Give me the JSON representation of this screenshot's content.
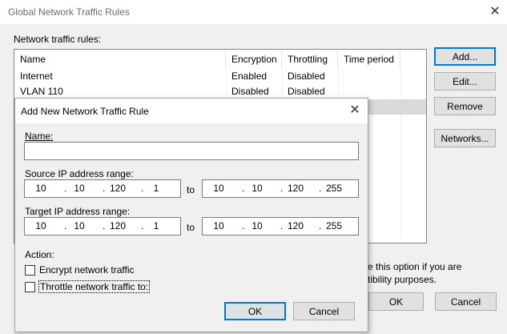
{
  "main": {
    "title": "Global Network Traffic Rules",
    "list_label": "Network traffic rules:",
    "columns": [
      "Name",
      "Encryption",
      "Throttling",
      "Time period"
    ],
    "rows": [
      {
        "name": "Internet",
        "encryption": "Enabled",
        "throttling": "Disabled",
        "time_period": ""
      },
      {
        "name": "VLAN 110",
        "encryption": "Disabled",
        "throttling": "Disabled",
        "time_period": ""
      }
    ],
    "buttons": {
      "add": "Add...",
      "edit": "Edit...",
      "remove": "Remove",
      "networks": "Networks..."
    },
    "hint_line1": "e this option if you are",
    "hint_line2": "tibility purposes.",
    "ok": "OK",
    "cancel": "Cancel"
  },
  "dialog": {
    "title": "Add New Network Traffic Rule",
    "name_label": "Name:",
    "name_value": "",
    "source_label": "Source IP address range:",
    "source_from": [
      "10",
      "10",
      "120",
      "1"
    ],
    "source_to": [
      "10",
      "10",
      "120",
      "255"
    ],
    "target_label": "Target IP address range:",
    "target_from": [
      "10",
      "10",
      "120",
      "1"
    ],
    "target_to": [
      "10",
      "10",
      "120",
      "255"
    ],
    "to_label": "to",
    "action_label": "Action:",
    "encrypt_label": "Encrypt network traffic",
    "encrypt_checked": false,
    "throttle_label": "Throttle network traffic to:",
    "throttle_checked": false,
    "ok": "OK",
    "cancel": "Cancel"
  }
}
